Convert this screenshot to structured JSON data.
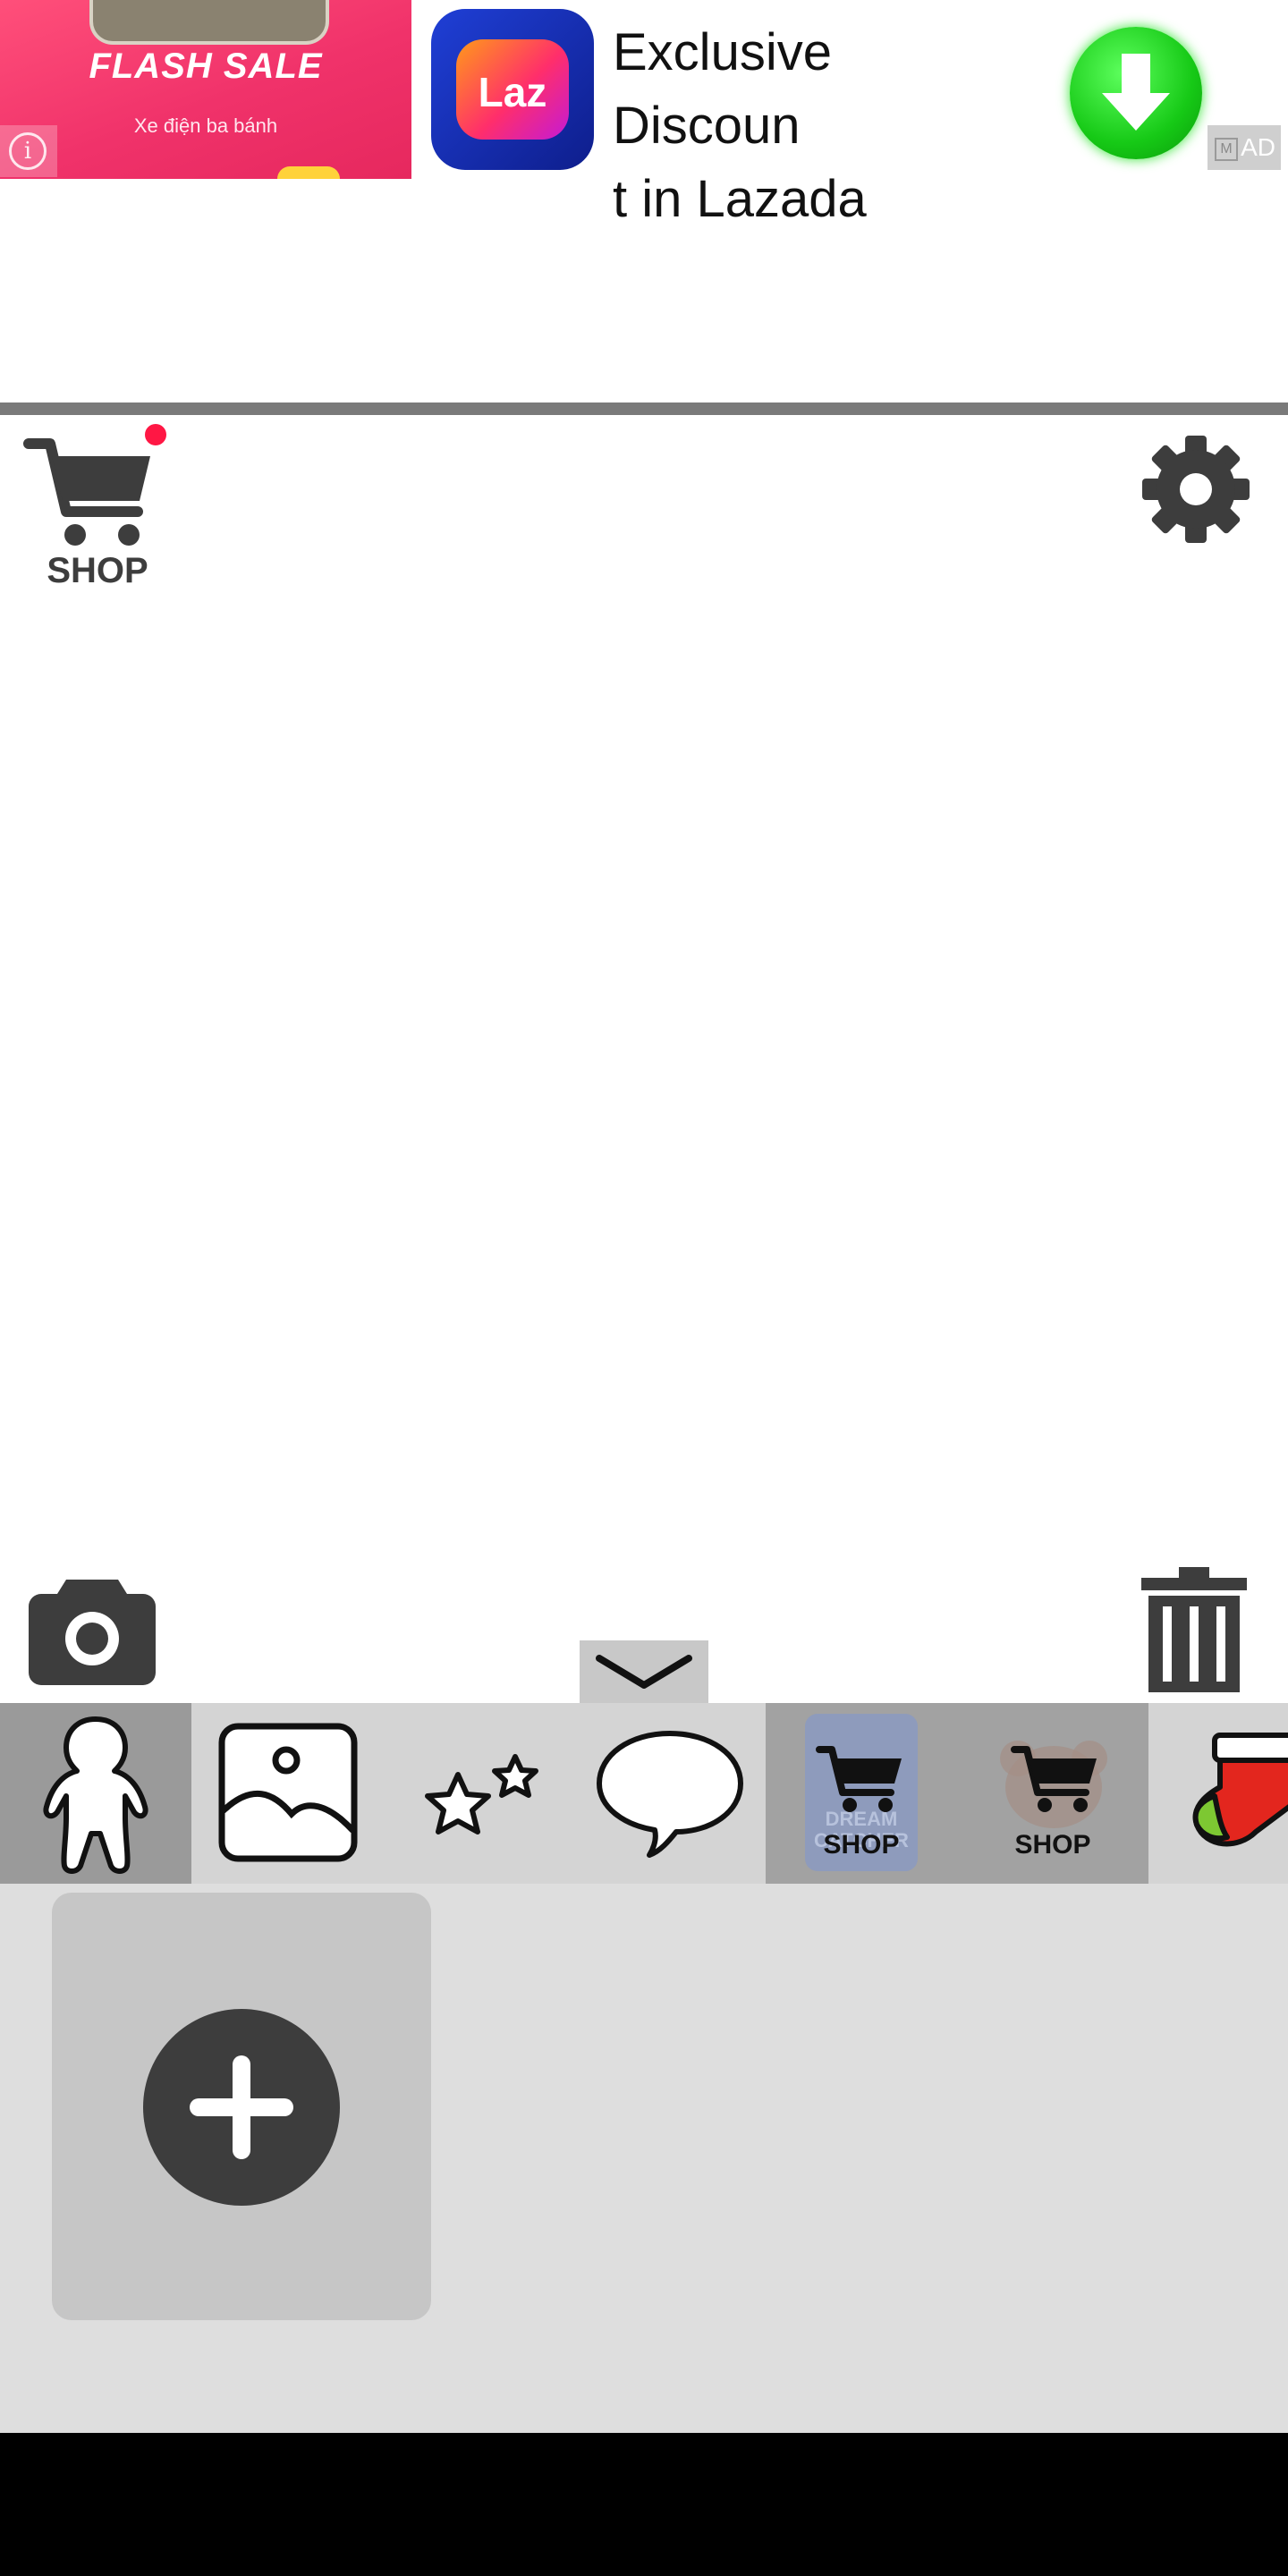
{
  "ad": {
    "flash_sale": "FLASH SALE",
    "product": "Xe điện ba bánh",
    "brand_logo_text": "Laz",
    "title_line1": "Exclusive Discoun",
    "title_line2": "t in Lazada",
    "badge": "AD",
    "badge_icon": "M",
    "info_icon": "i"
  },
  "toolbar": {
    "shop_label": "SHOP",
    "has_notification": true
  },
  "tabs": [
    {
      "name": "character",
      "selected": true
    },
    {
      "name": "background"
    },
    {
      "name": "stickers"
    },
    {
      "name": "speech-bubble"
    },
    {
      "name": "shop-dream-catcher",
      "label": "SHOP",
      "thumb_text_line1": "DREAM",
      "thumb_text_line2": "CATCHER"
    },
    {
      "name": "shop-bear",
      "label": "SHOP"
    },
    {
      "name": "christmas-stocking"
    }
  ],
  "colors": {
    "accent_red": "#ff1744",
    "icon_dark": "#3d3d3d",
    "ad_pink": "#f0326a",
    "download_green": "#16c916"
  }
}
